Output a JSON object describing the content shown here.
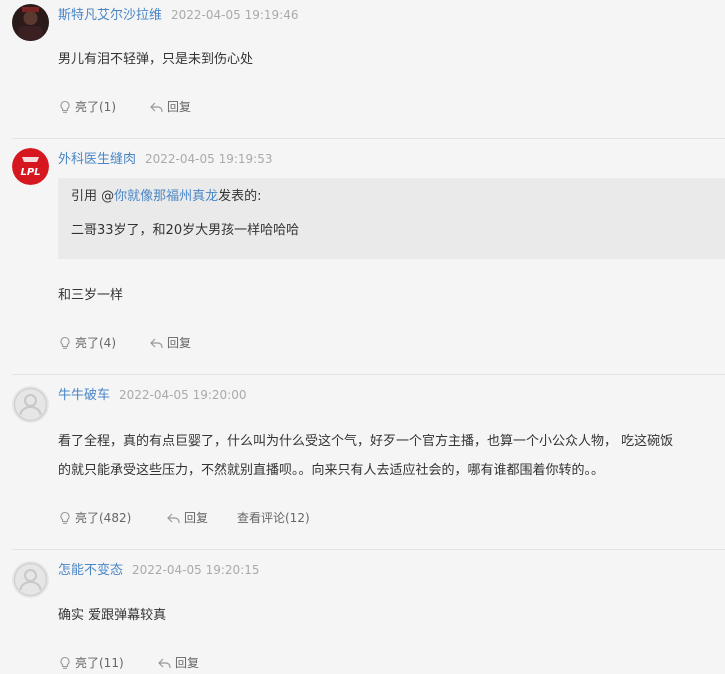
{
  "comments": [
    {
      "username": "斯特凡艾尔沙拉维",
      "time": "2022-04-05 19:19:46",
      "avatar_icon": "dark-photo-avatar",
      "text": [
        "男儿有泪不轻弹，只是未到伤心处"
      ],
      "like_label": "亮了(1)",
      "reply_label": "回复"
    },
    {
      "username": "外科医生缝肉",
      "time": "2022-04-05 19:19:53",
      "avatar_icon": "lpl-logo-avatar",
      "avatar_text": "LPL",
      "quote": {
        "prefix": "引用 @",
        "author": "你就像那福州真龙",
        "suffix": "发表的:",
        "text": "二哥33岁了，和20岁大男孩一样哈哈哈"
      },
      "text": [
        "和三岁一样"
      ],
      "like_label": "亮了(4)",
      "reply_label": "回复"
    },
    {
      "username": "牛牛破车",
      "time": "2022-04-05 19:20:00",
      "avatar_icon": "default-user-avatar",
      "text": [
        "看了全程，真的有点巨婴了，什么叫为什么受这个气，好歹一个官方主播，也算一个小公众人物， 吃这碗饭",
        "的就只能承受这些压力，不然就别直播呗。。向来只有人去适应社会的，哪有谁都围着你转的。。"
      ],
      "like_label": "亮了(482)",
      "reply_label": "回复",
      "view_comments_label": "查看评论(12)"
    },
    {
      "username": "怎能不变态",
      "time": "2022-04-05 19:20:15",
      "avatar_icon": "default-user-avatar",
      "text": [
        "确实 爱跟弹幕较真"
      ],
      "like_label": "亮了(11)",
      "reply_label": "回复"
    }
  ],
  "colors": {
    "background": "#f5f5f5",
    "username": "#4a86c5",
    "timestamp": "#aaaaaa",
    "quote_background": "#eaeaea",
    "lpl_red": "#d7171f"
  }
}
